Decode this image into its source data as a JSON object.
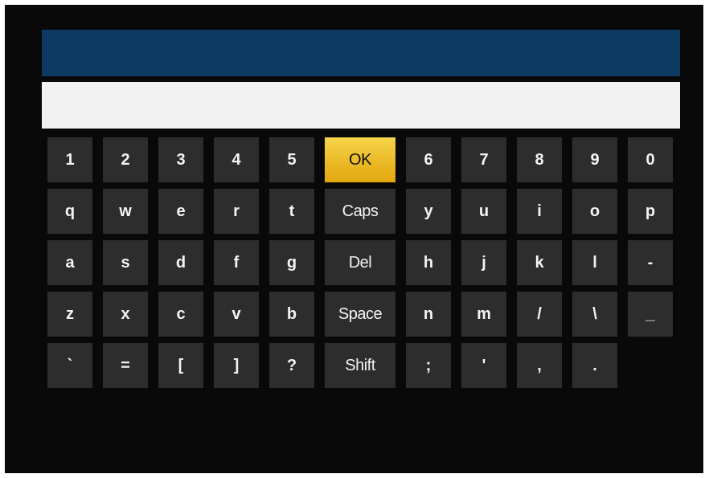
{
  "input": {
    "value": ""
  },
  "keyboard": {
    "rows": [
      [
        "1",
        "2",
        "3",
        "4",
        "5",
        "OK",
        "6",
        "7",
        "8",
        "9",
        "0"
      ],
      [
        "q",
        "w",
        "e",
        "r",
        "t",
        "Caps",
        "y",
        "u",
        "i",
        "o",
        "p"
      ],
      [
        "a",
        "s",
        "d",
        "f",
        "g",
        "Del",
        "h",
        "j",
        "k",
        "l",
        "-"
      ],
      [
        "z",
        "x",
        "c",
        "v",
        "b",
        "Space",
        "n",
        "m",
        "/",
        "\\",
        "_"
      ],
      [
        "`",
        "=",
        "[",
        "]",
        "?",
        "Shift",
        ";",
        "'",
        ",",
        "."
      ]
    ],
    "selected_key": "OK"
  },
  "colors": {
    "title_bar": "#0d3a63",
    "key_background": "#2d2d2d",
    "selected_key_background": "#f0c531"
  }
}
